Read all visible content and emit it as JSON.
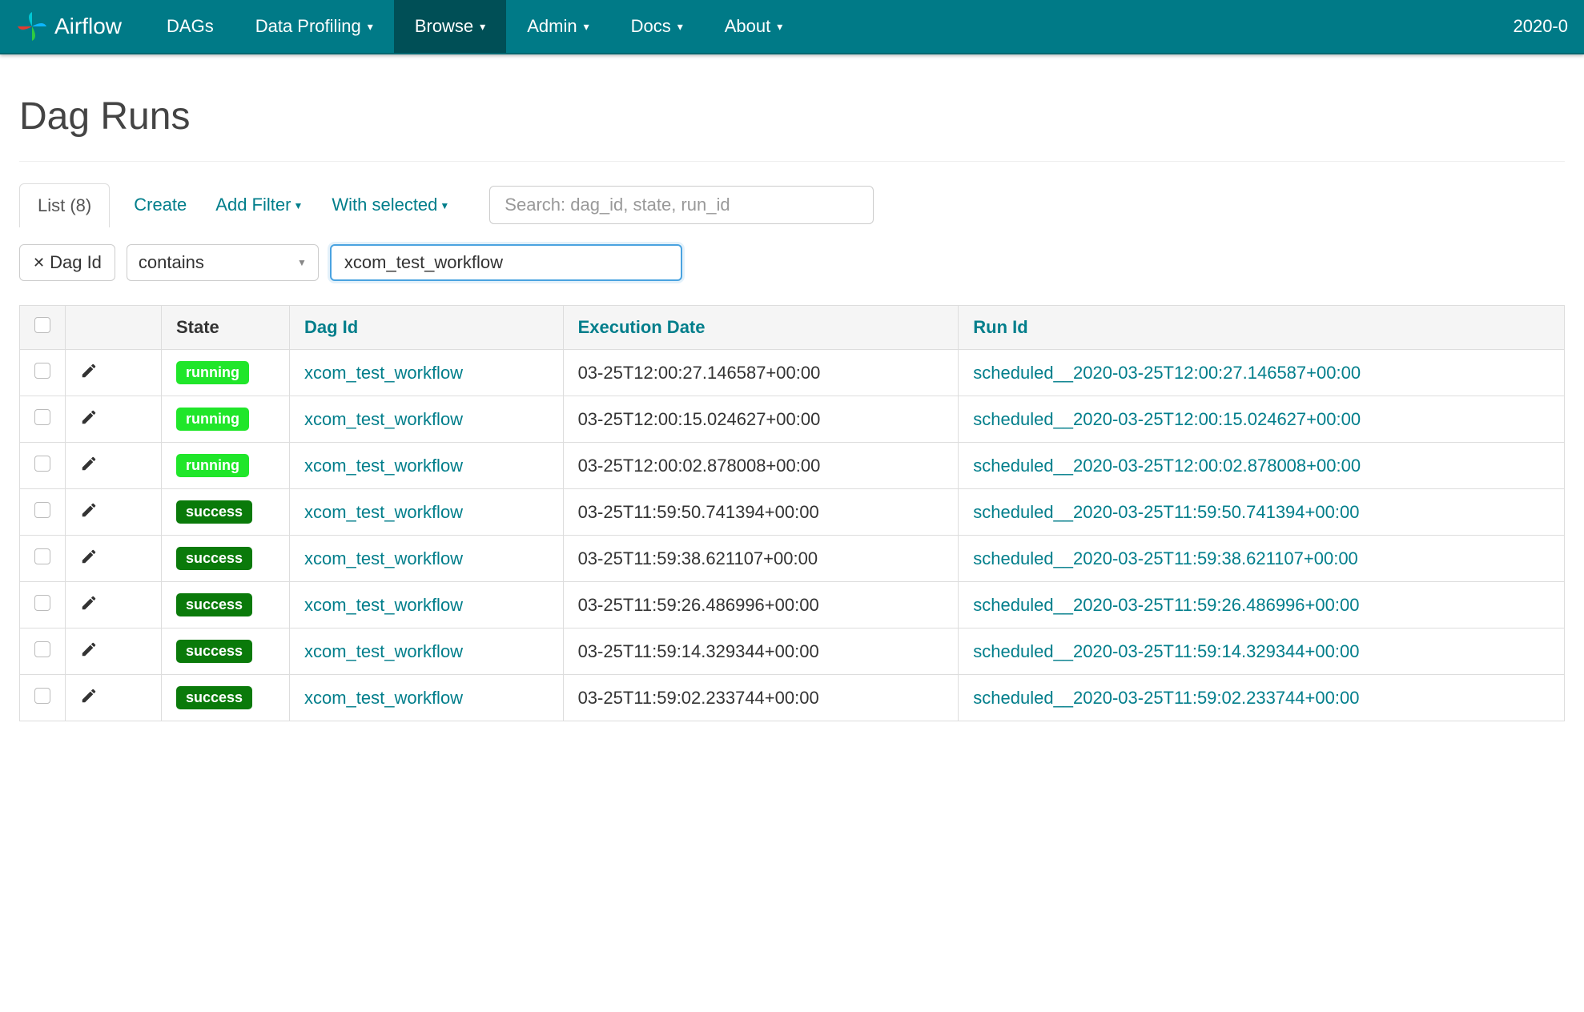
{
  "brand": "Airflow",
  "nav": {
    "items": [
      {
        "label": "DAGs",
        "dropdown": false,
        "active": false
      },
      {
        "label": "Data Profiling",
        "dropdown": true,
        "active": false
      },
      {
        "label": "Browse",
        "dropdown": true,
        "active": true
      },
      {
        "label": "Admin",
        "dropdown": true,
        "active": false
      },
      {
        "label": "Docs",
        "dropdown": true,
        "active": false
      },
      {
        "label": "About",
        "dropdown": true,
        "active": false
      }
    ],
    "clock": "2020-0"
  },
  "page_title": "Dag Runs",
  "tabs": {
    "list_label": "List (8)",
    "create": "Create",
    "add_filter": "Add Filter",
    "with_selected": "With selected"
  },
  "search_placeholder": "Search: dag_id, state, run_id",
  "filter": {
    "field_label": "Dag Id",
    "op": "contains",
    "value": "xcom_test_workflow"
  },
  "columns": {
    "state": "State",
    "dag_id": "Dag Id",
    "execution_date": "Execution Date",
    "run_id": "Run Id"
  },
  "rows": [
    {
      "state": "running",
      "dag_id": "xcom_test_workflow",
      "execution_date": "03-25T12:00:27.146587+00:00",
      "run_id": "scheduled__2020-03-25T12:00:27.146587+00:00"
    },
    {
      "state": "running",
      "dag_id": "xcom_test_workflow",
      "execution_date": "03-25T12:00:15.024627+00:00",
      "run_id": "scheduled__2020-03-25T12:00:15.024627+00:00"
    },
    {
      "state": "running",
      "dag_id": "xcom_test_workflow",
      "execution_date": "03-25T12:00:02.878008+00:00",
      "run_id": "scheduled__2020-03-25T12:00:02.878008+00:00"
    },
    {
      "state": "success",
      "dag_id": "xcom_test_workflow",
      "execution_date": "03-25T11:59:50.741394+00:00",
      "run_id": "scheduled__2020-03-25T11:59:50.741394+00:00"
    },
    {
      "state": "success",
      "dag_id": "xcom_test_workflow",
      "execution_date": "03-25T11:59:38.621107+00:00",
      "run_id": "scheduled__2020-03-25T11:59:38.621107+00:00"
    },
    {
      "state": "success",
      "dag_id": "xcom_test_workflow",
      "execution_date": "03-25T11:59:26.486996+00:00",
      "run_id": "scheduled__2020-03-25T11:59:26.486996+00:00"
    },
    {
      "state": "success",
      "dag_id": "xcom_test_workflow",
      "execution_date": "03-25T11:59:14.329344+00:00",
      "run_id": "scheduled__2020-03-25T11:59:14.329344+00:00"
    },
    {
      "state": "success",
      "dag_id": "xcom_test_workflow",
      "execution_date": "03-25T11:59:02.233744+00:00",
      "run_id": "scheduled__2020-03-25T11:59:02.233744+00:00"
    }
  ]
}
